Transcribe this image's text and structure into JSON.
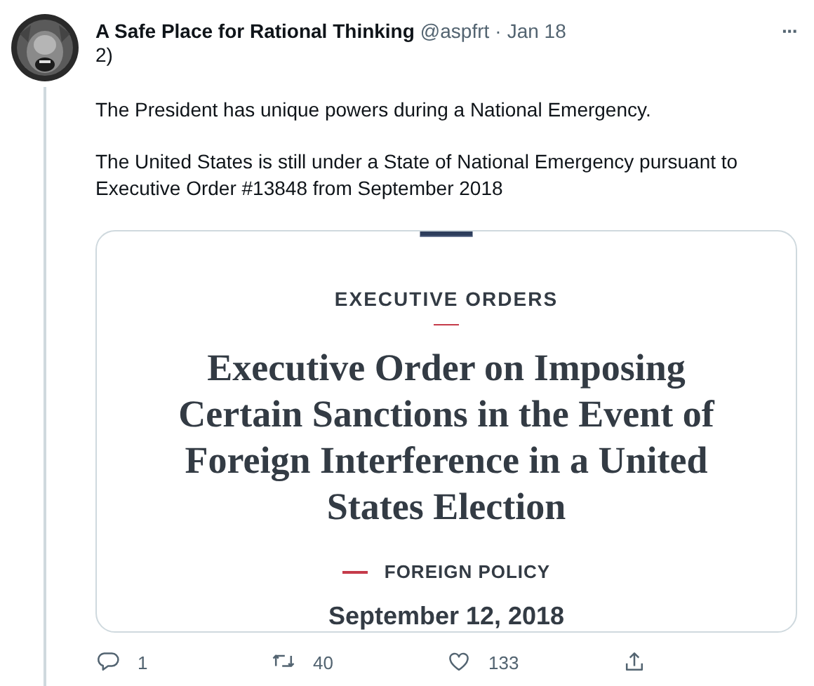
{
  "tweet": {
    "author": "A Safe Place for Rational Thinking",
    "handle": "@aspfrt",
    "separator": "·",
    "date": "Jan 18",
    "more": "···",
    "paragraphs": [
      "2)",
      "The President has unique powers during a National Emergency.",
      "The United States is still under a State of National Emergency pursuant to Executive Order #13848 from September 2018"
    ],
    "card": {
      "section": "EXECUTIVE ORDERS",
      "title": "Executive Order on Imposing Certain Sanctions in the Event of Foreign Interference in a United States Election",
      "category": "FOREIGN POLICY",
      "date": "September 12, 2018"
    },
    "actions": [
      {
        "kind": "reply",
        "count": "1"
      },
      {
        "kind": "retweet",
        "count": "40"
      },
      {
        "kind": "like",
        "count": "133"
      },
      {
        "kind": "share"
      }
    ]
  }
}
